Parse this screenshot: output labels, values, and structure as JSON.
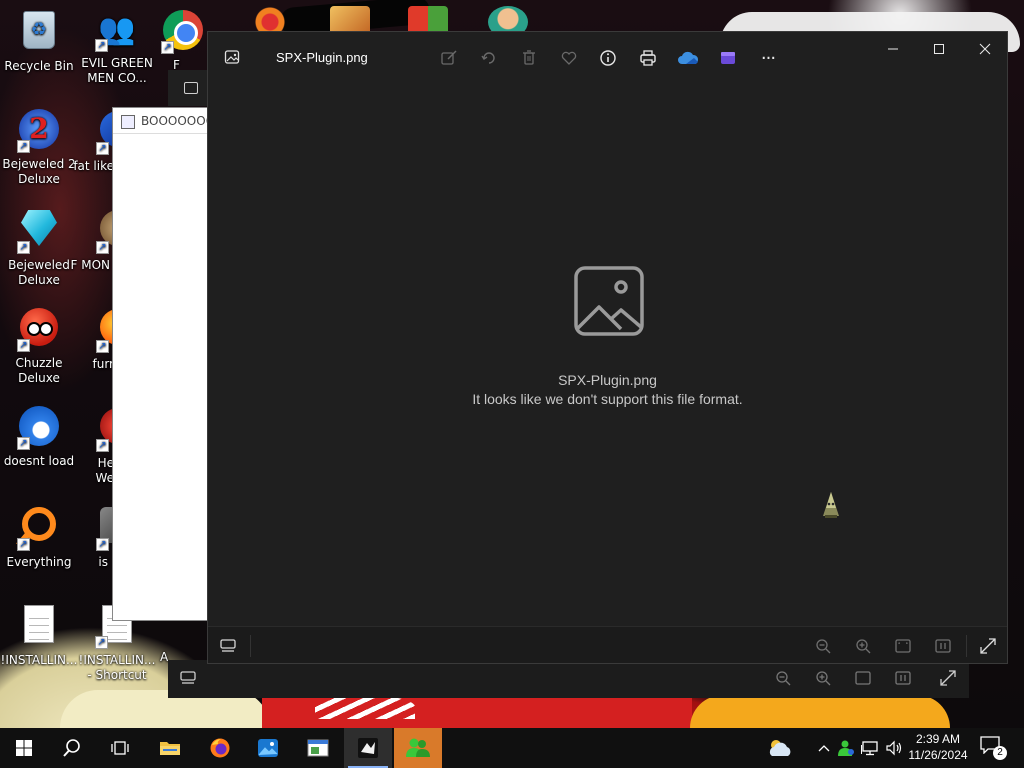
{
  "desktop": {
    "icons": [
      {
        "label": "Recycle Bin"
      },
      {
        "label": "EVIL GREEN MEN CO..."
      },
      {
        "label": "Bejeweled 2 Deluxe"
      },
      {
        "label": "fat like"
      },
      {
        "label": "Bejeweled Deluxe"
      },
      {
        "label": "F MON"
      },
      {
        "label": "Chuzzle Deluxe"
      },
      {
        "label": "furr"
      },
      {
        "label": "doesnt load"
      },
      {
        "label": "He We"
      },
      {
        "label": "Everything"
      },
      {
        "label": "is"
      },
      {
        "label": "!INSTALLIN..."
      },
      {
        "label": "!INSTALLIN... - Shortcut"
      },
      {
        "label": "A"
      }
    ]
  },
  "background_windows": {
    "notepad_title": "BOOOOOOO",
    "chrome_partial_label": "F"
  },
  "photos_window": {
    "file_name": "SPX-Plugin.png",
    "toolbar": {
      "edit": "edit-icon",
      "rotate": "rotate-icon",
      "delete": "delete-icon",
      "favorite": "heart-icon",
      "info": "info-icon",
      "print": "print-icon",
      "onedrive": "cloud-icon",
      "clipchamp": "clipchamp-icon",
      "more": "···"
    },
    "message": {
      "file_name": "SPX-Plugin.png",
      "error": "It looks like we don't support this file format."
    }
  },
  "taskbar": {
    "time": "2:39 AM",
    "date": "11/26/2024",
    "notification_count": "2",
    "colors": {
      "active_underline": "#8ab4f8",
      "highlight": "#d97a2a"
    }
  }
}
